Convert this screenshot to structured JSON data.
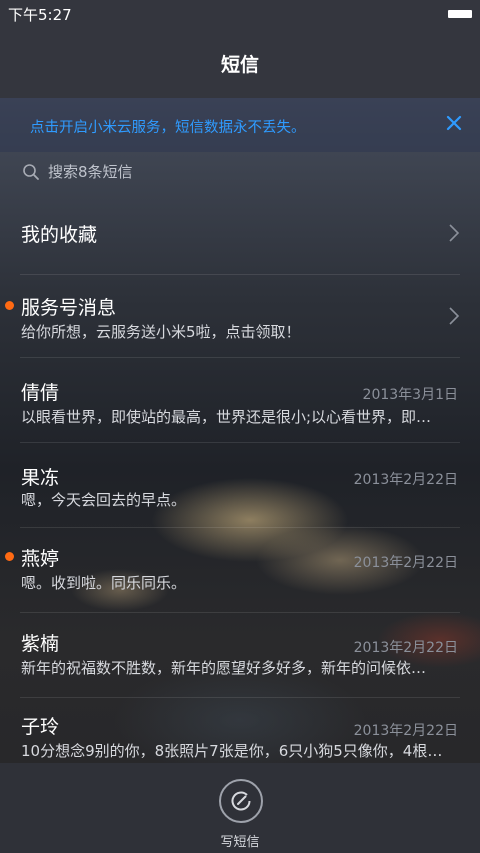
{
  "status_bar": {
    "time": "下午5:27",
    "battery_icon": "battery-icon"
  },
  "header": {
    "title": "短信"
  },
  "banner": {
    "text": "点击开启小米云服务，短信数据永不丢失。",
    "close_icon": "close-icon",
    "color": "#2f9bff"
  },
  "search": {
    "placeholder": "搜索8条短信",
    "icon": "search-icon"
  },
  "favorites": {
    "label": "我的收藏",
    "icon": "chevron-right-icon"
  },
  "conversations": [
    {
      "name": "服务号消息",
      "date": "",
      "preview": "给你所想，云服务送小米5啦，点击领取！",
      "unread": true,
      "chevron": true
    },
    {
      "name": "倩倩",
      "date": "2013年3月1日",
      "preview": "以眼看世界，即使站的最高，世界还是很小;以心看世界，即…",
      "unread": false,
      "chevron": false
    },
    {
      "name": "果冻",
      "date": "2013年2月22日",
      "preview": "嗯，今天会回去的早点。",
      "unread": false,
      "chevron": false
    },
    {
      "name": "燕婷",
      "date": "2013年2月22日",
      "preview": "嗯。收到啦。同乐同乐。",
      "unread": true,
      "chevron": false
    },
    {
      "name": "紫楠",
      "date": "2013年2月22日",
      "preview": "新年的祝福数不胜数，新年的愿望好多好多，新年的问候依…",
      "unread": false,
      "chevron": false
    },
    {
      "name": "子玲",
      "date": "2013年2月22日",
      "preview": "10分想念9别的你，8张照片7张是你，6只小狗5只像你，4根…",
      "unread": false,
      "chevron": false
    }
  ],
  "bottom": {
    "compose_label": "写短信",
    "compose_icon": "compose-icon"
  },
  "colors": {
    "unread_dot": "#ff6a13",
    "accent": "#2f9bff"
  }
}
